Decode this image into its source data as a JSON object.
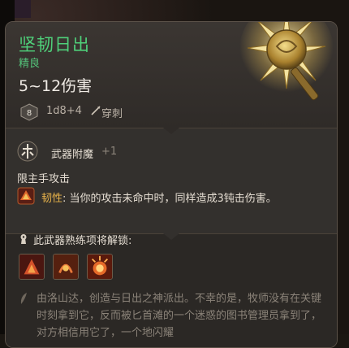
{
  "item": {
    "name": "坚韧日出",
    "rarity": "精良",
    "damage": "5~12伤害",
    "die": {
      "face": "8",
      "icon": "d8-die-icon"
    },
    "dice": "1d8+4",
    "damage_type": {
      "label": "穿刺",
      "icon": "piercing-icon"
    },
    "art": "morningstar-weapon-icon"
  },
  "enchant": {
    "icon": "weapon-enchant-icon",
    "label": "武器附魔",
    "value": "+1"
  },
  "mainhand": "限主手攻击",
  "passive": {
    "icon": "tenacity-passive-icon",
    "name": "韧性",
    "text": ": 当你的攻击未命中时，同样造成3钝击伤害。"
  },
  "proficiency": {
    "icon": "keyhole-icon",
    "text": "此武器熟练项将解锁:",
    "actions": [
      {
        "name": "action-icon-1"
      },
      {
        "name": "action-icon-2"
      },
      {
        "name": "action-icon-3"
      }
    ]
  },
  "flavor": {
    "icon": "feather-quill-icon",
    "text": "由洛山达，创造与日出之神派出。不幸的是，牧师没有在关键时刻拿到它，反而被匕首滩的一个迷惑的图书管理员拿到了，对方相信用它了，一个地闪耀"
  },
  "colors": {
    "name_green": "#4fd07a",
    "passive_gold": "#e8b34a",
    "panel": "#2f2b28"
  }
}
